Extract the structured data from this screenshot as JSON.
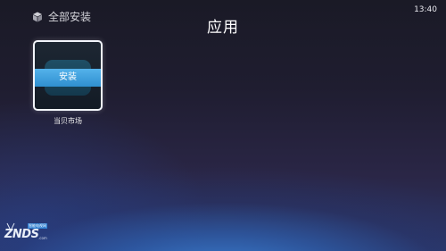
{
  "header": {
    "filter_label": "全部安装",
    "title": "应用",
    "clock": "13:40"
  },
  "apps": [
    {
      "name": "当贝市场",
      "action_label": "安装",
      "icon": "app-icon"
    }
  ],
  "watermark": {
    "text": "ZNDS",
    "subtitle": "智能电视网",
    "domain": ".com"
  },
  "colors": {
    "install_bar": "#3a9ee0",
    "tile_border": "#f2f5fb"
  }
}
